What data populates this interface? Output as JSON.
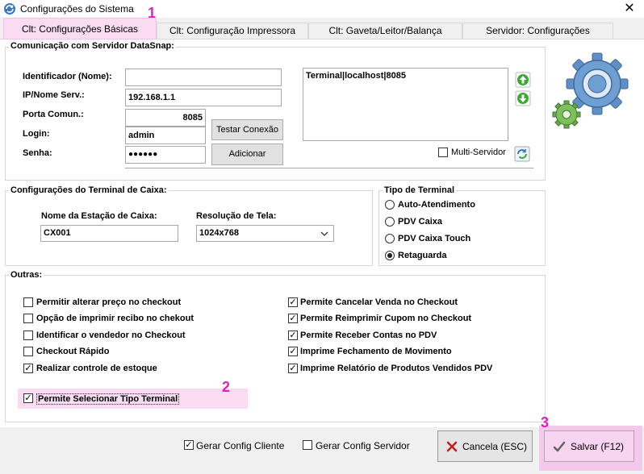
{
  "window": {
    "title": "Configurações do Sistema",
    "close_glyph": "✕"
  },
  "tabs": [
    {
      "label": "Clt: Configurações Básicas",
      "active": true
    },
    {
      "label": "Clt: Configuração Impressora",
      "active": false
    },
    {
      "label": "Clt: Gaveta/Leitor/Balança",
      "active": false
    },
    {
      "label": "Servidor: Configurações",
      "active": false
    }
  ],
  "markers": [
    "1",
    "2",
    "3"
  ],
  "server": {
    "group_label": "Comunicação com Servidor DataSnap:",
    "id_label": "Identificador (Nome):",
    "id_value": "",
    "ip_label": "IP/Nome Serv.:",
    "ip_value": "192.168.1.1",
    "port_label": "Porta Comun.:",
    "port_value": "8085",
    "login_label": "Login:",
    "login_value": "admin",
    "password_label": "Senha:",
    "password_value": "●●●●●●",
    "test_button": "Testar Conexão",
    "add_button": "Adicionar",
    "list_items": [
      "Terminal|localhost|8085"
    ],
    "multi_label": "Multi-Servidor",
    "multi_checked": false
  },
  "terminal_config": {
    "group_label": "Configurações do Terminal de Caixa:",
    "station_label": "Nome da Estação de Caixa:",
    "station_value": "CX001",
    "resolution_label": "Resolução de Tela:",
    "resolution_value": "1024x768"
  },
  "terminal_type": {
    "group_label": "Tipo de Terminal",
    "options": [
      {
        "label": "Auto-Atendimento",
        "selected": false
      },
      {
        "label": "PDV Caixa",
        "selected": false
      },
      {
        "label": "PDV Caixa Touch",
        "selected": false
      },
      {
        "label": "Retaguarda",
        "selected": true
      }
    ]
  },
  "others": {
    "group_label": "Outras:",
    "left": [
      {
        "label": "Permitir alterar preço no checkout",
        "checked": false
      },
      {
        "label": "Opção de imprimir recibo no chekout",
        "checked": false
      },
      {
        "label": "Identificar o vendedor no Checkout",
        "checked": false
      },
      {
        "label": "Checkout Rápido",
        "checked": false
      },
      {
        "label": "Realizar controle de estoque",
        "checked": true
      }
    ],
    "right": [
      {
        "label": "Permite Cancelar Venda no Checkout",
        "checked": true
      },
      {
        "label": "Permite Reimprimir Cupom no Checkout",
        "checked": true
      },
      {
        "label": "Permite Receber Contas no PDV",
        "checked": true
      },
      {
        "label": "Imprime Fechamento de Movimento",
        "checked": true
      },
      {
        "label": "Imprime Relatório de Produtos Vendidos PDV",
        "checked": true
      }
    ],
    "select_terminal": {
      "label": "Permite Selecionar Tipo Terminal",
      "checked": true
    }
  },
  "footer": {
    "gen_client_label": "Gerar Config Cliente",
    "gen_client_checked": true,
    "gen_server_label": "Gerar Config Servidor",
    "gen_server_checked": false,
    "cancel_label": "Cancela (ESC)",
    "save_label": "Salvar (F12)"
  },
  "colors": {
    "highlight": "#f9dcf2",
    "marker": "#e020c0",
    "cancel_icon": "#c0201e",
    "save_icon": "#606060"
  }
}
